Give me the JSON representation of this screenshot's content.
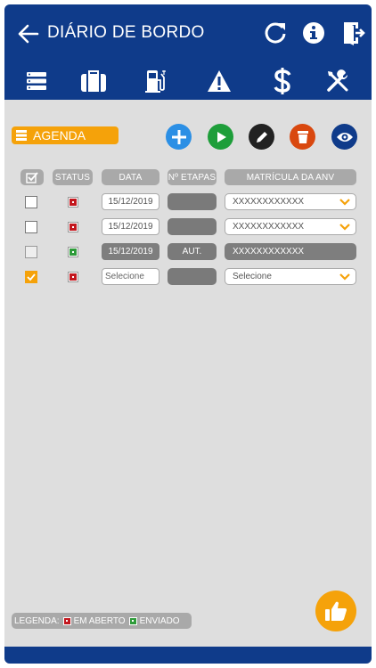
{
  "header": {
    "title": "DIÁRIO DE BORDO"
  },
  "toolbar": {
    "agenda_label": "AGENDA"
  },
  "table": {
    "columns": [
      "STATUS",
      "DATA",
      "Nº ETAPAS",
      "MATRÍCULA DA ANV"
    ],
    "rows": [
      {
        "checked": false,
        "status": "em-aberto",
        "date": "15/12/2019",
        "etapas": "",
        "matricula": "XXXXXXXXXXXX",
        "editable": true
      },
      {
        "checked": false,
        "status": "em-aberto",
        "date": "15/12/2019",
        "etapas": "",
        "matricula": "XXXXXXXXXXXX",
        "editable": true
      },
      {
        "checked": false,
        "status": "enviado",
        "date": "15/12/2019",
        "etapas": "AUT.",
        "matricula": "XXXXXXXXXXXX",
        "editable": false
      },
      {
        "checked": true,
        "status": "em-aberto",
        "date": "Selecione",
        "etapas": "",
        "matricula": "Selecione",
        "editable": true
      }
    ]
  },
  "legend": {
    "label": "LEGENDA:",
    "open": "EM ABERTO",
    "sent": "ENVIADO"
  },
  "colors": {
    "primary": "#0f3b8a",
    "accent": "#f5a20a",
    "open": "#c3171e",
    "sent": "#2e9b3a",
    "add": "#2b8fe5",
    "play": "#1e9e3a",
    "delete": "#d9480f"
  }
}
